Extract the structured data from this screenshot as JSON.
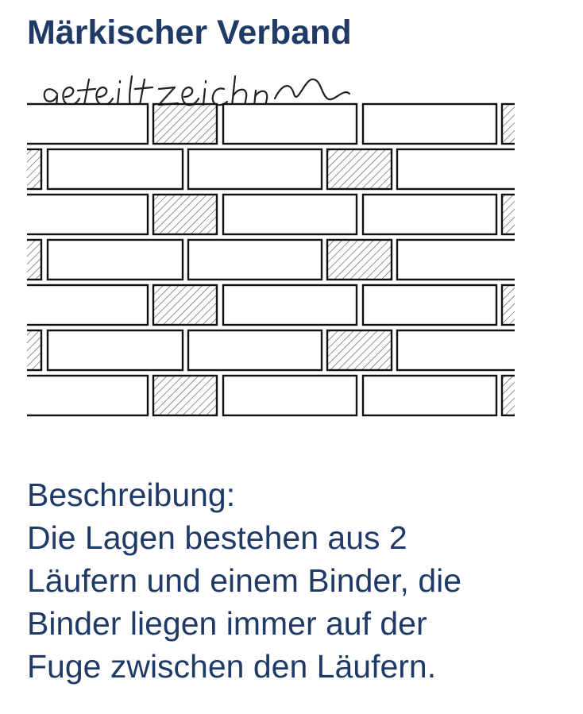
{
  "title": "Märkischer Verband",
  "handwritten_label": "geteilt zeichnen",
  "description": {
    "heading": "Beschreibung:",
    "line1": "Die Lagen bestehen aus 2",
    "line2": "Läufern und einem Binder, die",
    "line3": "Binder liegen immer auf der",
    "line4": "Fuge zwischen den Läufern."
  },
  "colors": {
    "text": "#1f3a66",
    "brick_stroke": "#111111",
    "binder_hatch": "#555555"
  },
  "courses": 7
}
